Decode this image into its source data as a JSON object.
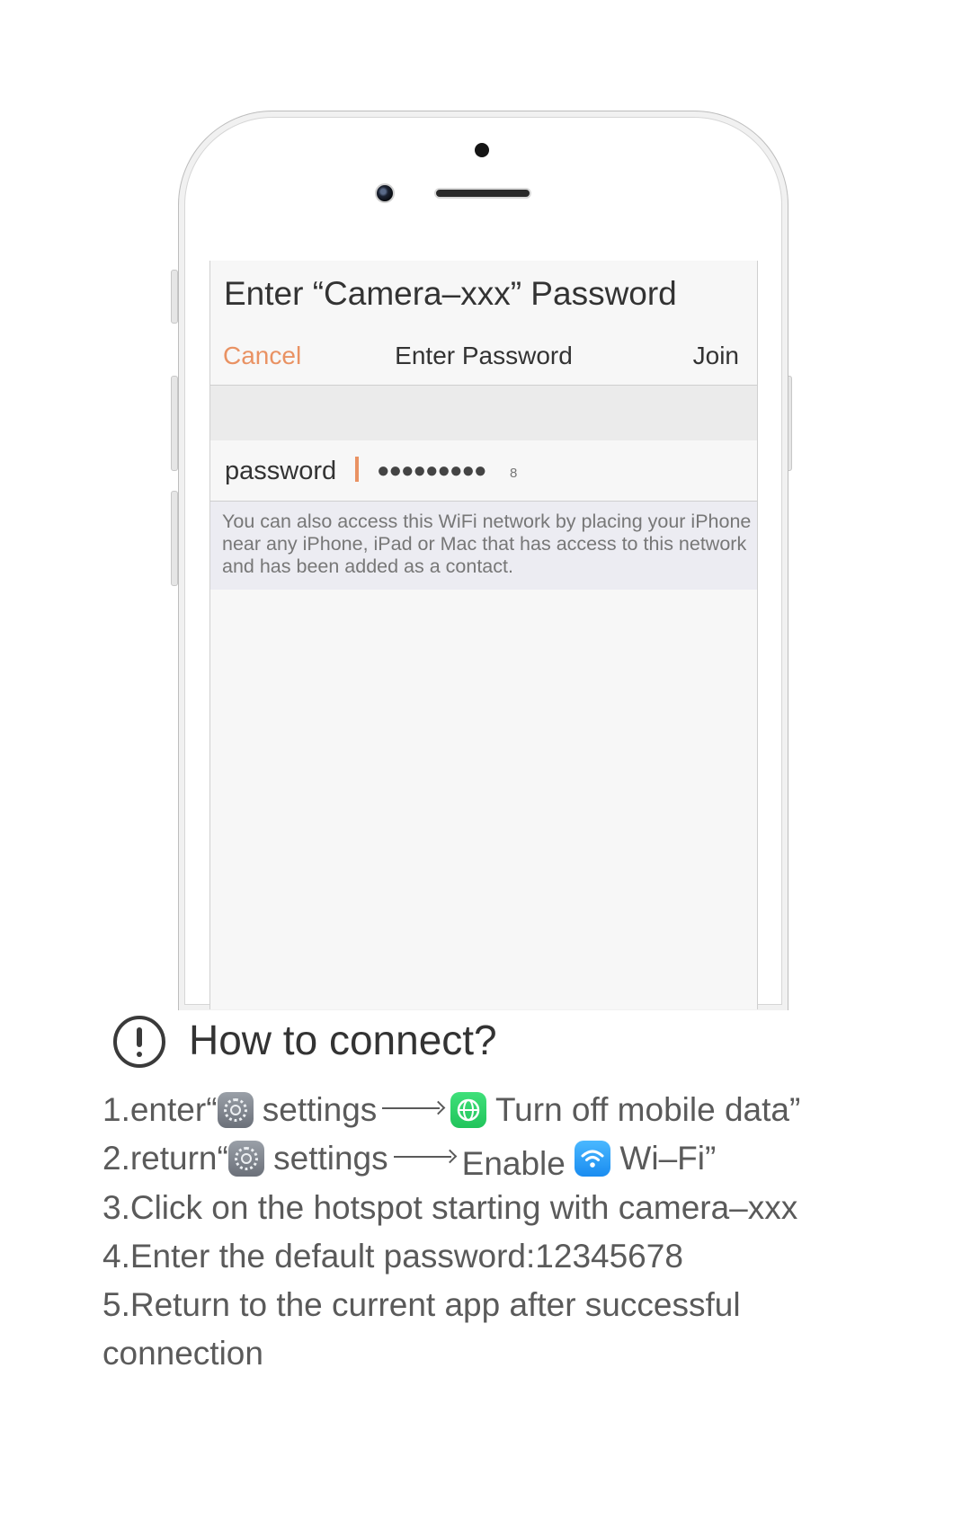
{
  "screen": {
    "title": "Enter “Camera–xxx” Password",
    "nav": {
      "cancel": "Cancel",
      "title": "Enter Password",
      "join": "Join"
    },
    "password": {
      "label": "password",
      "masked": "●●●●●●●●●",
      "last_char": "8"
    },
    "hint": "You can also access this WiFi network by placing your iPhone near any iPhone, iPad or Mac that has access to this network and has been added as a contact."
  },
  "instructions": {
    "title": "How to connect?",
    "step1": {
      "prefix": "1.enter“",
      "settings": "settings",
      "action": "Turn off mobile data”"
    },
    "step2": {
      "prefix": "2.return“",
      "settings": "settings",
      "enable": "Enable",
      "wifi": "Wi–Fi”"
    },
    "step3": "3.Click on the hotspot starting with camera–xxx",
    "step4": "4.Enter the default password:12345678",
    "step5_line1": "5.Return to the current app after successful",
    "step5_line2": "connection"
  },
  "colors": {
    "accent_orange": "#e99263",
    "text_dark": "#333333",
    "text_grey": "#5a5a5a",
    "hint_background": "#ececf2"
  },
  "icons": [
    "settings-icon",
    "mobile-data-icon",
    "wifi-icon",
    "exclamation-icon",
    "arrow-right-icon"
  ]
}
